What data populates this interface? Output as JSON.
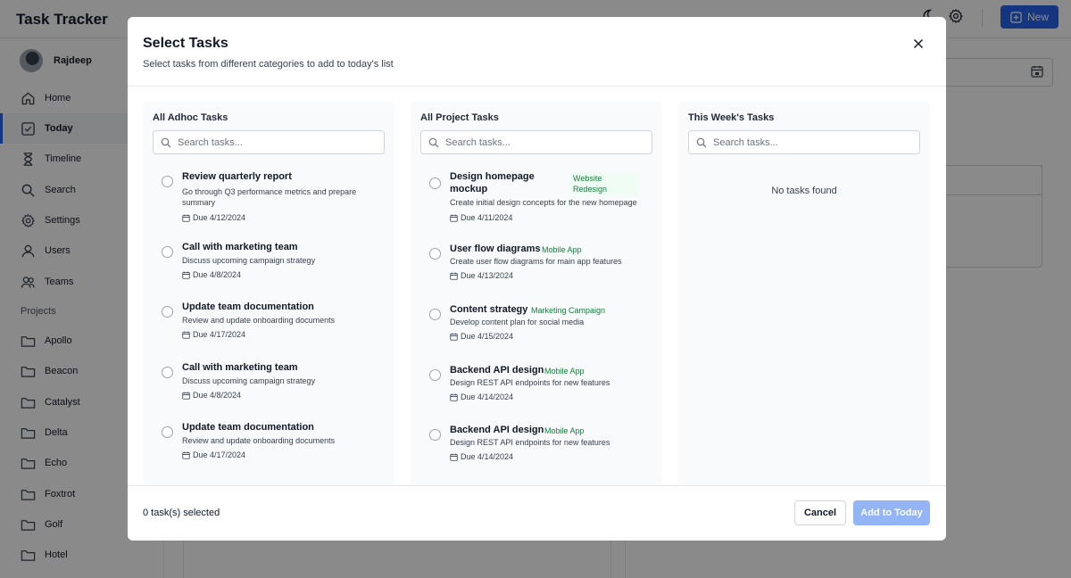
{
  "app": {
    "title": "Task Tracker",
    "new_label": "New"
  },
  "user": {
    "name": "Rajdeep"
  },
  "nav": [
    {
      "label": "Home",
      "icon": "home-icon"
    },
    {
      "label": "Today",
      "icon": "calendar-check-icon",
      "active": true
    },
    {
      "label": "Timeline",
      "icon": "hourglass-icon"
    },
    {
      "label": "Search",
      "icon": "search-icon"
    },
    {
      "label": "Settings",
      "icon": "gear-icon"
    },
    {
      "label": "Users",
      "icon": "user-icon"
    },
    {
      "label": "Teams",
      "icon": "users-icon"
    }
  ],
  "projects_label": "Projects",
  "projects": [
    "Apollo",
    "Beacon",
    "Catalyst",
    "Delta",
    "Echo",
    "Foxtrot",
    "Golf",
    "Hotel"
  ],
  "modal": {
    "title": "Select Tasks",
    "subtitle": "Select tasks from different categories to add to today's list",
    "columns": {
      "adhoc": {
        "title": "All Adhoc Tasks",
        "search_placeholder": "Search tasks...",
        "tasks": [
          {
            "title": "Review quarterly report",
            "desc": "Go through Q3 performance metrics and prepare summary",
            "due": "Due 4/12/2024"
          },
          {
            "title": "Call with marketing team",
            "desc": "Discuss upcoming campaign strategy",
            "due": "Due 4/8/2024"
          },
          {
            "title": "Update team documentation",
            "desc": "Review and update onboarding documents",
            "due": "Due 4/17/2024"
          },
          {
            "title": "Call with marketing team",
            "desc": "Discuss upcoming campaign strategy",
            "due": "Due 4/8/2024"
          },
          {
            "title": "Update team documentation",
            "desc": "Review and update onboarding documents",
            "due": "Due 4/17/2024"
          }
        ]
      },
      "project": {
        "title": "All Project Tasks",
        "search_placeholder": "Search tasks...",
        "tasks": [
          {
            "title": "Design homepage mockup",
            "tag": "Website Redesign",
            "desc": "Create initial design concepts for the new homepage",
            "due": "Due 4/11/2024"
          },
          {
            "title": "User flow diagrams",
            "tag": "Mobile App",
            "desc": "Create user flow diagrams for main app features",
            "due": "Due 4/13/2024"
          },
          {
            "title": "Content strategy",
            "tag": "Marketing Campaign",
            "desc": "Develop content plan for social media",
            "due": "Due 4/15/2024"
          },
          {
            "title": "Backend API design",
            "tag": "Mobile App",
            "desc": "Design REST API endpoints for new features",
            "due": "Due 4/14/2024"
          },
          {
            "title": "Backend API design",
            "tag": "Mobile App",
            "desc": "Design REST API endpoints for new features",
            "due": "Due 4/14/2024"
          }
        ]
      },
      "week": {
        "title": "This Week's Tasks",
        "search_placeholder": "Search tasks...",
        "empty": "No tasks found"
      }
    },
    "footer": {
      "selected": "0 task(s) selected",
      "cancel": "Cancel",
      "add": "Add to Today"
    }
  },
  "colors": {
    "accent": "#2563eb",
    "tag_text": "#15803d",
    "add_disabled": "#93b4f5"
  }
}
